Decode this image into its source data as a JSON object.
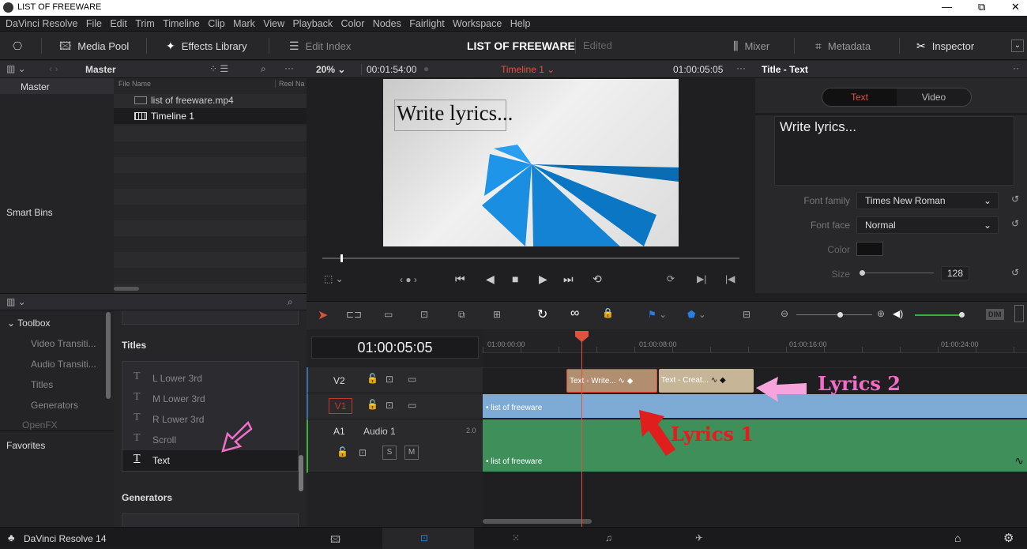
{
  "window": {
    "title": "LIST OF FREEWARE",
    "min": "—",
    "restore": "⧉",
    "close": "✕"
  },
  "menu": [
    "DaVinci Resolve",
    "File",
    "Edit",
    "Trim",
    "Timeline",
    "Clip",
    "Mark",
    "View",
    "Playback",
    "Color",
    "Nodes",
    "Fairlight",
    "Workspace",
    "Help"
  ],
  "toolbar": {
    "media_pool": "Media Pool",
    "effects_library": "Effects Library",
    "edit_index": "Edit Index",
    "project_title": "LIST OF FREEWARE",
    "status": "Edited",
    "mixer": "Mixer",
    "metadata": "Metadata",
    "inspector": "Inspector"
  },
  "media": {
    "master": "Master",
    "bins_master": "Master",
    "smart_bins": "Smart Bins",
    "col_file": "File Name",
    "col_reel": "Reel Na",
    "items": [
      "list of freeware.mp4",
      "Timeline 1"
    ]
  },
  "viewer": {
    "zoom": "20%",
    "duration": "00:01:54:00",
    "timeline_name": "Timeline 1",
    "timecode": "01:00:05:05",
    "overlay_text": "Write lyrics..."
  },
  "inspector": {
    "title": "Title - Text",
    "tab_text": "Text",
    "tab_video": "Video",
    "text_value": "Write lyrics...",
    "font_family_label": "Font family",
    "font_family": "Times New Roman",
    "font_face_label": "Font face",
    "font_face": "Normal",
    "color_label": "Color",
    "color_value": "#111111",
    "size_label": "Size",
    "size_value": "128"
  },
  "toolbox": {
    "title": "Toolbox",
    "items": [
      "Video Transiti...",
      "Audio Transiti...",
      "Titles",
      "Generators",
      "OpenFX"
    ],
    "favorites": "Favorites"
  },
  "effects": {
    "titles_header": "Titles",
    "titles": [
      "L Lower 3rd",
      "M Lower 3rd",
      "R Lower 3rd",
      "Scroll",
      "Text"
    ],
    "generators_header": "Generators"
  },
  "timeline": {
    "timecode": "01:00:05:05",
    "ruler": [
      "01:00:00:00",
      "01:00:08:00",
      "01:00:16:00",
      "01:00:24:00"
    ],
    "tracks": {
      "v2": "V2",
      "v1": "V1",
      "a1": "A1",
      "a1_name": "Audio 1",
      "a1_ch": "2.0",
      "s": "S",
      "m": "M"
    },
    "clips": {
      "text1": "Text - Write...",
      "text2": "Text - Creat...",
      "video": "• list of freeware",
      "audio": "• list of freeware"
    },
    "dim": "DIM"
  },
  "annotations": {
    "lyrics1": "Lyrics 1",
    "lyrics2": "Lyrics 2"
  },
  "footer": {
    "app": "DaVinci Resolve 14"
  }
}
